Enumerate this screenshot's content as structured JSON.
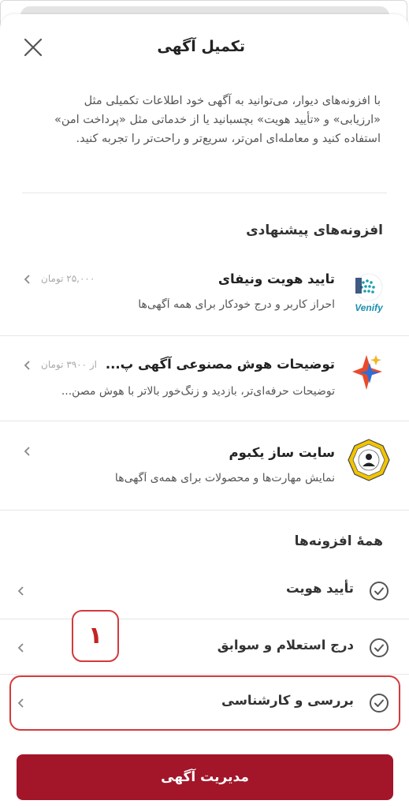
{
  "header": {
    "title": "تکمیل آگهی"
  },
  "intro": {
    "text": "با افزونه‌های دیوار، می‌توانید به آگهی خود اطلاعات تکمیلی مثل «ارزیابی» و «تأیید هویت» بچسبانید یا از خدماتی مثل «پرداخت امن» استفاده کنید و معامله‌ای امن‌تر، سریع‌تر و راحت‌تر را تجربه کنید."
  },
  "suggested": {
    "title": "افزونه‌های پیشنهادی",
    "items": [
      {
        "name": "تایید هویت ونیفای",
        "description": "احراز کاربر و درج خودکار برای همه آگهی‌ها",
        "price": "۲۵,۰۰۰ تومان",
        "logo_text": "Venify"
      },
      {
        "name": "توضیحات هوش مصنوعی آگهی پ...",
        "description": "توضیحات حرفه‌ای‌تر، بازدید و زنگ‌خور بالاتر با هوش مصن...",
        "price": "از ۳۹۰۰ تومان"
      },
      {
        "name": "سایت ساز یکبوم",
        "description": "نمایش مهارت‌ها و محصولات برای همه‌ی آگهی‌ها",
        "price": ""
      }
    ]
  },
  "all_addons": {
    "title": "همهٔ افزونه‌ها",
    "items": [
      {
        "label": "تأیید هویت"
      },
      {
        "label": "درج استعلام و سوابق"
      },
      {
        "label": "بررسی و کارشناسی"
      }
    ]
  },
  "annotation": {
    "badge_number": "۱"
  },
  "footer": {
    "button_label": "مدیریت آگهی"
  },
  "colors": {
    "brand": "#a3162a",
    "annotation": "#d43a3a"
  }
}
